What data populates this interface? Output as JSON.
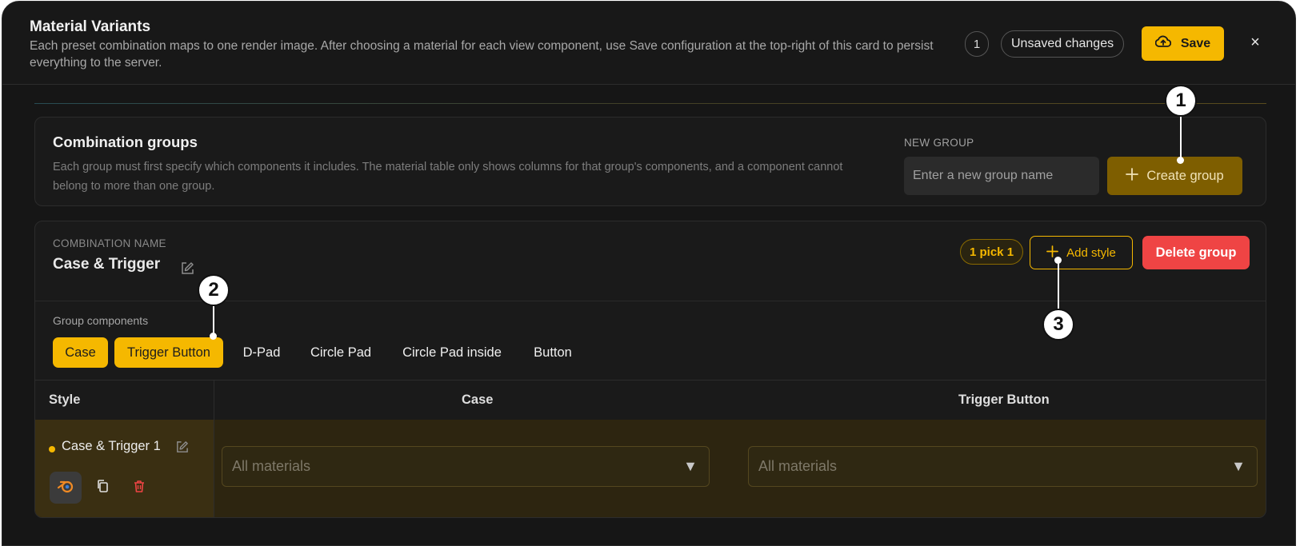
{
  "header": {
    "title": "Material Variants",
    "subtitle": "Each preset combination maps to one render image. After choosing a material for each view component, use Save configuration at the top-right of this card to persist everything to the server.",
    "count": "1",
    "unsaved_label": "Unsaved changes",
    "save_label": "Save",
    "close_glyph": "×"
  },
  "groups": {
    "title": "Combination groups",
    "description": "Each group must first specify which components it includes. The material table only shows columns for that group's components, and a component cannot belong to more than one group.",
    "new_group_label": "NEW GROUP",
    "new_group_placeholder": "Enter a new group name",
    "new_group_value": "",
    "create_label": "Create group"
  },
  "group": {
    "name_label": "COMBINATION NAME",
    "name": "Case & Trigger",
    "pick_badge": "1 pick 1",
    "add_style_label": "Add style",
    "delete_label": "Delete group",
    "components_label": "Group components",
    "components": [
      {
        "label": "Case",
        "selected": true
      },
      {
        "label": "Trigger Button",
        "selected": true
      },
      {
        "label": "D-Pad",
        "selected": false
      },
      {
        "label": "Circle Pad",
        "selected": false
      },
      {
        "label": "Circle Pad inside",
        "selected": false
      },
      {
        "label": "Button",
        "selected": false
      }
    ],
    "table": {
      "headers": [
        "Style",
        "Case",
        "Trigger Button"
      ],
      "rows": [
        {
          "style_name": "Case & Trigger 1",
          "case_material": "All materials",
          "trigger_material": "All materials"
        }
      ]
    }
  },
  "callouts": [
    "1",
    "2",
    "3"
  ],
  "colors": {
    "accent": "#f5b800",
    "danger": "#ef4444",
    "background": "#161616",
    "selected_row": "#2d2510"
  },
  "icons": [
    "cloud-upload-icon",
    "close-icon",
    "plus-icon",
    "edit-icon",
    "blender-icon",
    "duplicate-icon",
    "trash-icon",
    "chevron-down-icon"
  ]
}
